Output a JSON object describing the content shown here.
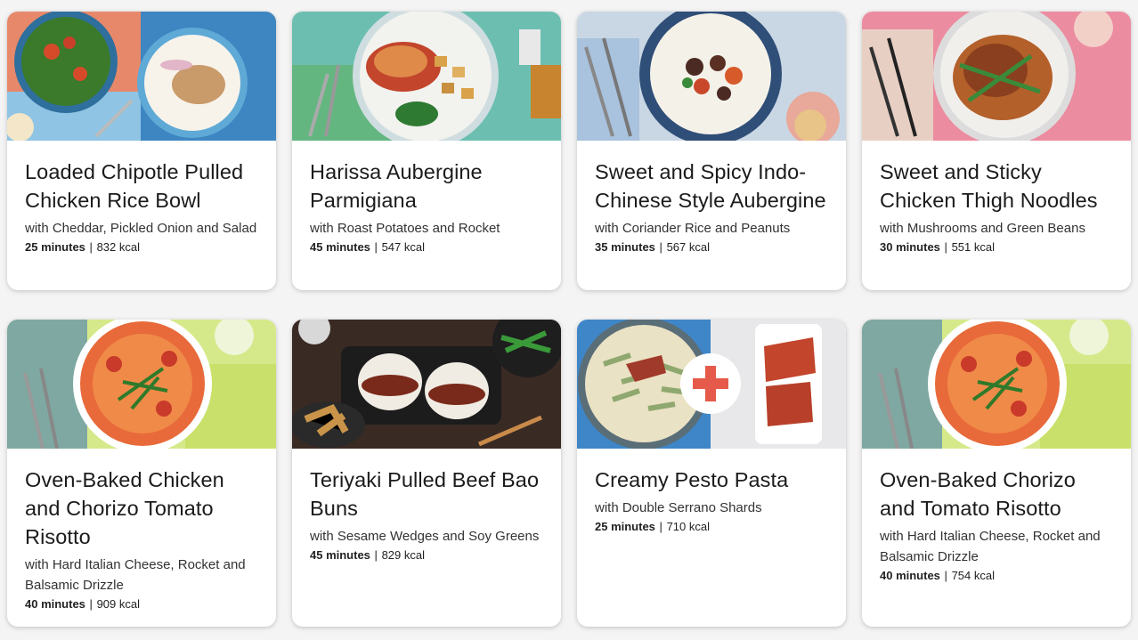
{
  "recipes": [
    {
      "title": "Loaded Chipotle Pulled Chicken Rice Bowl",
      "subtitle": "with Cheddar, Pickled Onion and Salad",
      "time": "25 minutes",
      "separator": "|",
      "kcal": "832 kcal"
    },
    {
      "title": "Harissa Aubergine Parmigiana",
      "subtitle": "with Roast Potatoes and Rocket",
      "time": "45 minutes",
      "separator": "|",
      "kcal": "547 kcal"
    },
    {
      "title": "Sweet and Spicy Indo-Chinese Style Aubergine",
      "subtitle": "with Coriander Rice and Peanuts",
      "time": "35 minutes",
      "separator": "|",
      "kcal": "567 kcal"
    },
    {
      "title": "Sweet and Sticky Chicken Thigh Noodles",
      "subtitle": "with Mushrooms and Green Beans",
      "time": "30 minutes",
      "separator": "|",
      "kcal": "551 kcal"
    },
    {
      "title": "Oven-Baked Chicken and Chorizo Tomato Risotto",
      "subtitle": "with Hard Italian Cheese, Rocket and Balsamic Drizzle",
      "time": "40 minutes",
      "separator": "|",
      "kcal": "909 kcal"
    },
    {
      "title": "Teriyaki Pulled Beef Bao Buns",
      "subtitle": "with Sesame Wedges and Soy Greens",
      "time": "45 minutes",
      "separator": "|",
      "kcal": "829 kcal"
    },
    {
      "title": "Creamy Pesto Pasta",
      "subtitle": "with Double Serrano Shards",
      "time": "25 minutes",
      "separator": "|",
      "kcal": "710 kcal"
    },
    {
      "title": "Oven-Baked Chorizo and Tomato Risotto",
      "subtitle": "with Hard Italian Cheese, Rocket and Balsamic Drizzle",
      "time": "40 minutes",
      "separator": "|",
      "kcal": "754 kcal"
    }
  ]
}
